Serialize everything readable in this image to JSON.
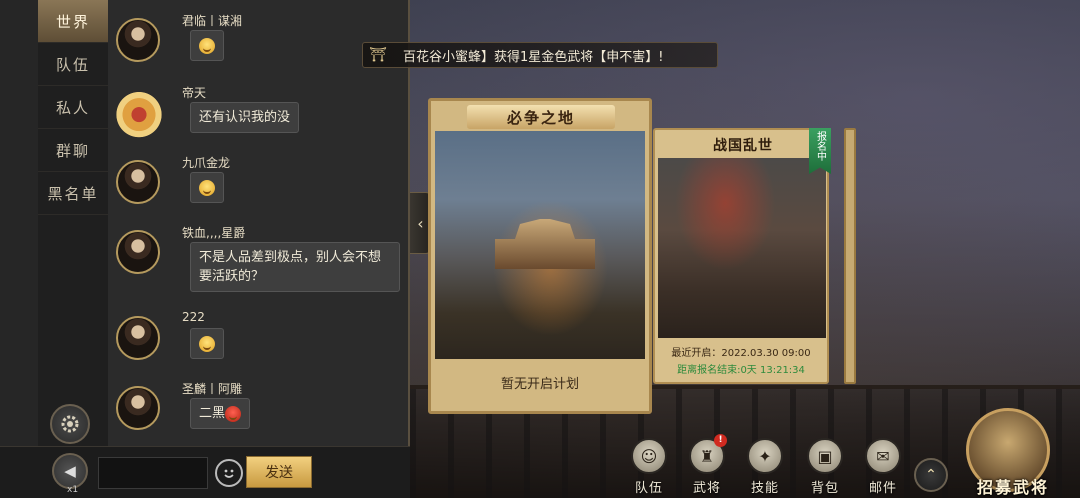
{
  "chat": {
    "tabs": [
      "世界",
      "队伍",
      "私人",
      "群聊",
      "黑名单"
    ],
    "active_tab": "世界",
    "messages": [
      {
        "name": "君临丨谋湘",
        "text": "",
        "emoji": "smile-emoji"
      },
      {
        "name": "帝天",
        "text": "还有认识我的没",
        "emoji": ""
      },
      {
        "name": "九爪金龙",
        "text": "",
        "emoji": "smile-emoji"
      },
      {
        "name": "铁血,,,,星爵",
        "text": "不是人品差到极点，别人会不想要活跃的？",
        "emoji": ""
      },
      {
        "name": "222",
        "text": "",
        "emoji": "smile-emoji"
      },
      {
        "name": "圣麟丨阿雕",
        "text": "二黑",
        "emoji": "red-face-emoji"
      }
    ],
    "input": {
      "value": "",
      "placeholder": ""
    },
    "send_label": "发送",
    "voice_count": "x1"
  },
  "announcement": {
    "text": "百花谷小蜜蜂】获得1星金色武将【申不害】!"
  },
  "events": {
    "card1": {
      "title": "必争之地",
      "status": "暂无开启计划"
    },
    "card2": {
      "title": "战国乱世",
      "badge": "报名中",
      "open_time": "最近开启：2022.03.30 09:00",
      "countdown": "距离报名结束:0天 13:21:34"
    }
  },
  "menu": {
    "items": [
      {
        "label": "队伍",
        "icon": "team-icon",
        "glyph": "☺"
      },
      {
        "label": "武将",
        "icon": "general-icon",
        "glyph": "♜"
      },
      {
        "label": "技能",
        "icon": "skill-icon",
        "glyph": "✦"
      },
      {
        "label": "背包",
        "icon": "bag-icon",
        "glyph": "▣"
      },
      {
        "label": "邮件",
        "icon": "mail-icon",
        "glyph": "✉"
      }
    ],
    "alert": "!",
    "recruit_label": "招募武将"
  },
  "colors": {
    "accent_gold": "#c8a060",
    "send_button": "#e6c070",
    "countdown_green": "#2d8a3c",
    "badge_green": "#2e8a50",
    "alert_red": "#d02a20"
  }
}
